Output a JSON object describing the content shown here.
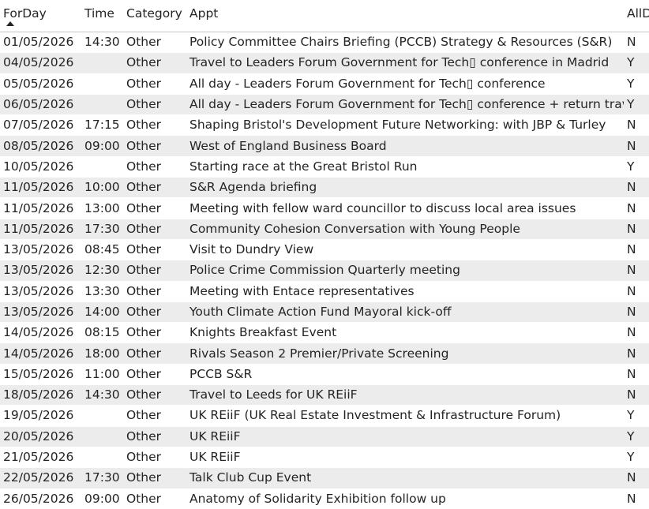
{
  "table": {
    "columns": [
      "ForDay",
      "Time",
      "Category",
      "Appt",
      "AllDay"
    ],
    "sort": {
      "column": "ForDay",
      "direction": "ascending"
    },
    "rows": [
      {
        "date": "01/05/2026",
        "time": "14:30",
        "category": "Other",
        "appt": "Policy Committee Chairs Briefing (PCCB) Strategy & Resources (S&R)",
        "allday": "N"
      },
      {
        "date": "04/05/2026",
        "time": "",
        "category": "Other",
        "appt": "Travel to Leaders Forum Government for Tech▯ conference in Madrid",
        "allday": "Y"
      },
      {
        "date": "05/05/2026",
        "time": "",
        "category": "Other",
        "appt": "All day - Leaders Forum Government for Tech▯ conference",
        "allday": "Y"
      },
      {
        "date": "06/05/2026",
        "time": "",
        "category": "Other",
        "appt": "All day - Leaders Forum Government for Tech▯ conference + return travel",
        "allday": "Y"
      },
      {
        "date": "07/05/2026",
        "time": "17:15",
        "category": "Other",
        "appt": "Shaping Bristol's Development Future Networking: with JBP & Turley",
        "allday": "N"
      },
      {
        "date": "08/05/2026",
        "time": "09:00",
        "category": "Other",
        "appt": "West of England Business Board",
        "allday": "N"
      },
      {
        "date": "10/05/2026",
        "time": "",
        "category": "Other",
        "appt": "Starting race at the Great Bristol Run",
        "allday": "Y"
      },
      {
        "date": "11/05/2026",
        "time": "10:00",
        "category": "Other",
        "appt": "S&R Agenda briefing",
        "allday": "N"
      },
      {
        "date": "11/05/2026",
        "time": "13:00",
        "category": "Other",
        "appt": "Meeting with fellow ward councillor to discuss local area issues",
        "allday": "N"
      },
      {
        "date": "11/05/2026",
        "time": "17:30",
        "category": "Other",
        "appt": "Community Cohesion Conversation with Young People",
        "allday": "N"
      },
      {
        "date": "13/05/2026",
        "time": "08:45",
        "category": "Other",
        "appt": "Visit to Dundry View",
        "allday": "N"
      },
      {
        "date": "13/05/2026",
        "time": "12:30",
        "category": "Other",
        "appt": "Police Crime Commission Quarterly meeting",
        "allday": "N"
      },
      {
        "date": "13/05/2026",
        "time": "13:30",
        "category": "Other",
        "appt": "Meeting with Entace representatives",
        "allday": "N"
      },
      {
        "date": "13/05/2026",
        "time": "14:00",
        "category": "Other",
        "appt": "Youth Climate Action Fund Mayoral kick-off",
        "allday": "N"
      },
      {
        "date": "14/05/2026",
        "time": "08:15",
        "category": "Other",
        "appt": "Knights Breakfast Event",
        "allday": "N"
      },
      {
        "date": "14/05/2026",
        "time": "18:00",
        "category": "Other",
        "appt": "Rivals Season 2 Premier/Private Screening",
        "allday": "N"
      },
      {
        "date": "15/05/2026",
        "time": "11:00",
        "category": "Other",
        "appt": "PCCB S&R",
        "allday": "N"
      },
      {
        "date": "18/05/2026",
        "time": "14:30",
        "category": "Other",
        "appt": "Travel to Leeds for UK REiiF",
        "allday": "N"
      },
      {
        "date": "19/05/2026",
        "time": "",
        "category": "Other",
        "appt": "UK REiiF (UK Real Estate Investment & Infrastructure Forum)",
        "allday": "Y"
      },
      {
        "date": "20/05/2026",
        "time": "",
        "category": "Other",
        "appt": "UK REiiF",
        "allday": "Y"
      },
      {
        "date": "21/05/2026",
        "time": "",
        "category": "Other",
        "appt": "UK REiiF",
        "allday": "Y"
      },
      {
        "date": "22/05/2026",
        "time": "17:30",
        "category": "Other",
        "appt": "Talk Club Cup Event",
        "allday": "N"
      },
      {
        "date": "26/05/2026",
        "time": "09:00",
        "category": "Other",
        "appt": "Anatomy of Solidarity Exhibition follow up",
        "allday": "N"
      }
    ]
  },
  "icons": {
    "sort": "sort-ascending-triangle-icon"
  },
  "colors": {
    "row_alt": "#ececec",
    "row": "#ffffff",
    "text": "#252423"
  }
}
